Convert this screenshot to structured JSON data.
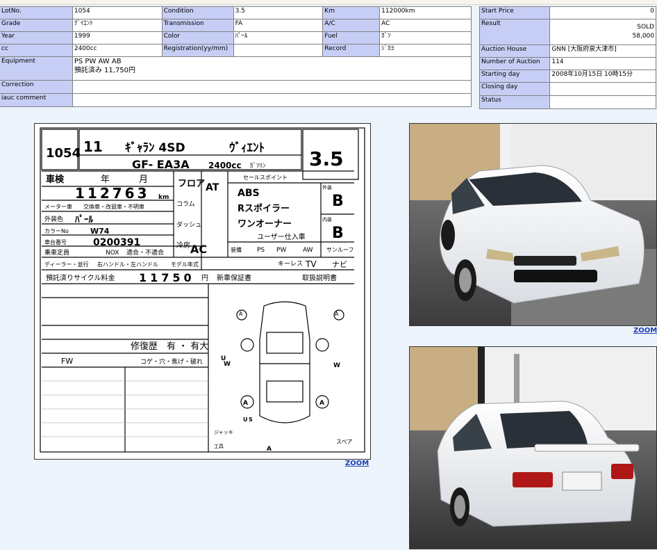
{
  "vehicle": {
    "lot_label": "LotNo.",
    "lot_value": "1054",
    "condition_label": "Condition",
    "condition_value": "3.5",
    "km_label": "Km",
    "km_value": "112000km",
    "grade_label": "Grade",
    "grade_value": "ｸﾞｲｴﾝﾄ",
    "transmission_label": "Transmission",
    "transmission_value": "FA",
    "ac_label": "A/C",
    "ac_value": "AC",
    "year_label": "Year",
    "year_value": "1999",
    "color_label": "Color",
    "color_value": "ﾊﾟｰﾙ",
    "fuel_label": "Fuel",
    "fuel_value": "ｶﾞｿ",
    "cc_label": "cc",
    "cc_value": "2400cc",
    "registration_label": "Registration(yy/mm)",
    "registration_value": "",
    "record_label": "Record",
    "record_value": "ｼﾞｶﾖ",
    "equipment_label": "Equipment",
    "equipment_line1": "PS PW AW AB",
    "equipment_line2": "預託済み 11,750円",
    "correction_label": "Correction",
    "correction_value": "",
    "iauc_label": "iauc comment",
    "iauc_value": ""
  },
  "auction": {
    "start_price_label": "Start Price",
    "start_price_value": "0",
    "result_label": "Result",
    "result_line1": "SOLD",
    "result_line2": "58,000",
    "house_label": "Auction House",
    "house_value": "GNN [大阪府泉大津市]",
    "number_label": "Number of Auction",
    "number_value": "114",
    "starting_label": "Starting day",
    "starting_value": "2008年10月15日 10時15分",
    "closing_label": "Closing day",
    "closing_value": "",
    "status_label": "Status",
    "status_value": ""
  },
  "sheet": {
    "lot": "1054",
    "year_hand": "11",
    "model_hand": "ｷﾞｬﾗﾝ 4SD",
    "grade_hand": "ｳﾞｨｴﾝﾄ",
    "score_hand": "3.5",
    "chassis_hand": "GF- EA3A",
    "cc_hand": "2400cc",
    "fuel_hand": "ｶﾞｿﾘﾝ",
    "shaken_label": "車検",
    "year_label": "年",
    "month_label": "月",
    "odometer_hand": "112763",
    "odometer_unit": "km",
    "meter_label": "メーター車",
    "meter_options": "交換車・改竄車・不明車",
    "color_label": "外装色",
    "color_hand": "ﾊﾟｰﾙ",
    "color_no_label": "カラーNo",
    "color_no_hand": "W74",
    "frame_no_label": "車台番号",
    "frame_no_hand": "0200391",
    "capacity_label": "乗車定員",
    "nox_label": "NOX",
    "nox_options": "適合・不適合",
    "handle_label": "ディーラー・並行",
    "handle_options": "右ハンドル・左ハンドル",
    "model_year_label": "モデル年式",
    "recycle_label": "預託済りサイクル料金",
    "recycle_hand": "11750",
    "recycle_unit": "円",
    "warranty_label": "新車保証書",
    "manual_label": "取扱説明書",
    "column_label": "コラム",
    "dash_label": "ダッシュ",
    "floor_label": "フロア",
    "at_label": "AT",
    "ac_label": "AC",
    "cooling_label": "冷房",
    "sales_point_label": "セールスポイント",
    "sales_points": [
      "ABS",
      "Rスポイラー",
      "ワンオーナー",
      "ユーザー仕入車"
    ],
    "exterior_label": "外装",
    "exterior_grade": "B",
    "interior_label": "内装",
    "interior_grade": "B",
    "equip_label": "装備",
    "sunroof_label": "サンルーフ",
    "tv_label": "TV",
    "navi_label": "ナビ",
    "keyless_label": "キーレス",
    "ps_label": "PS",
    "pw_label": "PW",
    "aw_label": "AW",
    "repair_label": "修復歴",
    "repair_options": "有 ・ 有大",
    "fw_label": "FW",
    "damage_options": "コゲ・穴・焦げ・破れ",
    "spare_label": "スペア",
    "jack_label": "ジャッキ",
    "tools_label": "工具",
    "diagram_marks": [
      "A",
      "A",
      "U",
      "W",
      "W",
      "A",
      "A",
      "U",
      "S",
      "A"
    ]
  },
  "links": {
    "zoom_sheet": "ZOOM",
    "zoom_photo": "ZOOM"
  },
  "colors": {
    "label_bg": "#c6cef5",
    "page_bg": "#eef4fb",
    "link": "#1a3db8"
  }
}
